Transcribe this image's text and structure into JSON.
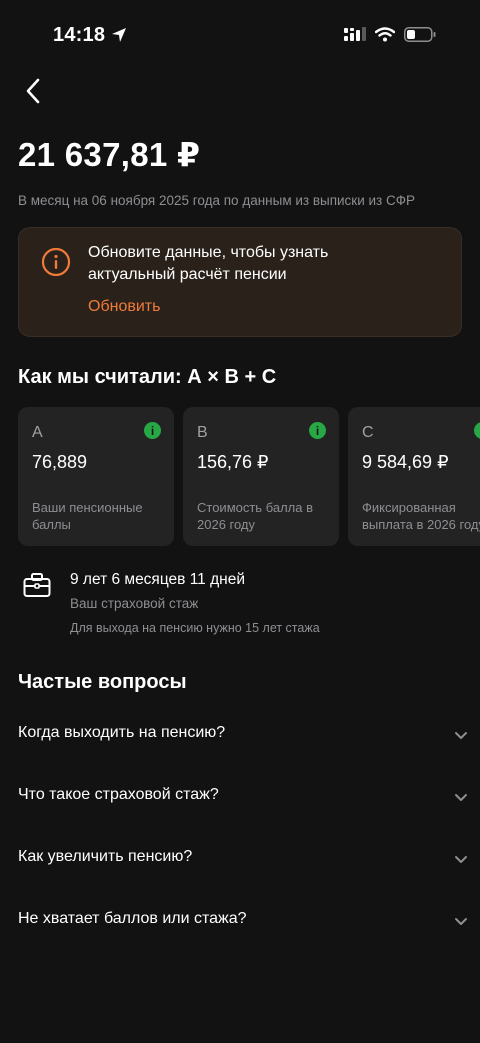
{
  "status": {
    "time": "14:18"
  },
  "pension": {
    "amount": "21 637,81 ₽",
    "subtitle": "В месяц на 06 ноября 2025 года по данным из выписки из СФР"
  },
  "alert": {
    "text": "Обновите данные, чтобы узнать актуальный расчёт пенсии",
    "action": "Обновить",
    "accent": "#f07a3a"
  },
  "calculation": {
    "title": "Как мы считали: А × В + С",
    "cards": [
      {
        "letter": "А",
        "value": "76,889",
        "caption": "Ваши пенсионные баллы"
      },
      {
        "letter": "В",
        "value": "156,76 ₽",
        "caption": "Стоимость балла в 2026 году"
      },
      {
        "letter": "С",
        "value": "9 584,69 ₽",
        "caption": "Фиксированная выплата в 2026 году"
      }
    ]
  },
  "experience": {
    "value": "9 лет 6 месяцев 11 дней",
    "label": "Ваш страховой стаж",
    "note": "Для выхода на пенсию нужно 15 лет стажа"
  },
  "faq": {
    "title": "Частые вопросы",
    "items": [
      {
        "label": "Когда выходить на пенсию?"
      },
      {
        "label": "Что такое страховой стаж?"
      },
      {
        "label": "Как увеличить пенсию?"
      },
      {
        "label": "Не хватает баллов или стажа?"
      }
    ]
  },
  "colors": {
    "background": "#121212",
    "card": "#232323",
    "info_green": "#27a844",
    "muted_text": "#8e8e93"
  }
}
